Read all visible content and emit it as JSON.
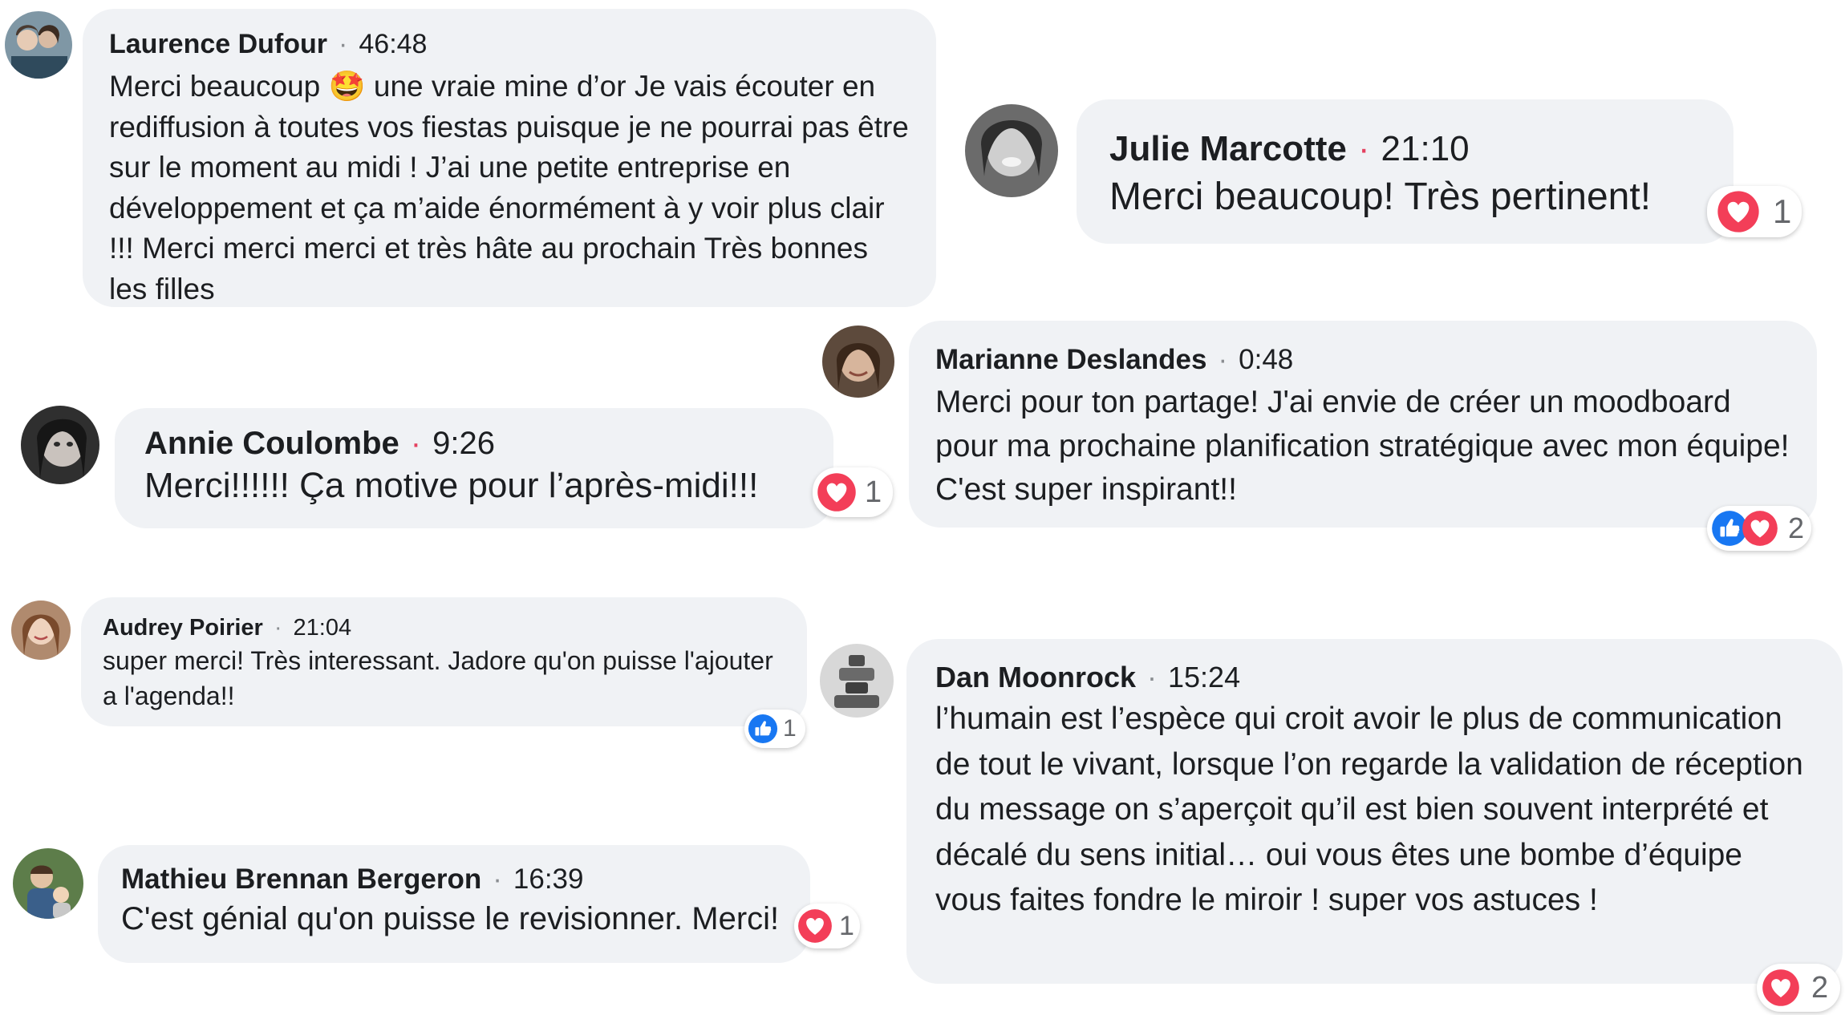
{
  "colors": {
    "bubble": "#f0f2f5",
    "like": "#1877f2",
    "love": "#f33e58",
    "muted": "#65676b"
  },
  "comments": [
    {
      "author": "Laurence Dufour",
      "time": "46:48",
      "text": "Merci beaucoup 🤩 une vraie mine d’or Je vais écouter en rediffusion à toutes vos fiestas puisque je ne pourrai pas être sur le moment au midi ! J’ai une petite entreprise en développement et ça m’aide énormément à y voir plus clair !!! Merci merci merci et très hâte au prochain Très bonnes les filles"
    },
    {
      "author": "Julie Marcotte",
      "time": "21:10",
      "text": "Merci beaucoup! Très pertinent!",
      "reactions": {
        "icons": [
          "love-icon"
        ],
        "count": "1"
      }
    },
    {
      "author": "Marianne Deslandes",
      "time": "0:48",
      "text": "Merci pour ton partage! J'ai envie de créer un moodboard pour ma prochaine planification stratégique avec mon équipe! C'est super inspirant!!",
      "reactions": {
        "icons": [
          "like-icon",
          "love-icon"
        ],
        "count": "2"
      }
    },
    {
      "author": "Annie Coulombe",
      "time": "9:26",
      "text": "Merci!!!!!! Ça motive pour l’après-midi!!!",
      "reactions": {
        "icons": [
          "love-icon"
        ],
        "count": "1"
      }
    },
    {
      "author": "Audrey Poirier",
      "time": "21:04",
      "text": "super merci! Très interessant. Jadore qu'on puisse l'ajouter a l'agenda!!",
      "reactions": {
        "icons": [
          "like-icon"
        ],
        "count": "1"
      }
    },
    {
      "author": "Dan Moonrock",
      "time": "15:24",
      "text": "l’humain est l’espèce qui croit avoir le plus de communication de tout le vivant, lorsque l’on regarde la validation de réception du message on s’aperçoit qu’il est bien souvent interprété et décalé du sens initial… oui vous êtes une bombe d’équipe vous faites fondre le miroir ! super vos astuces !",
      "reactions": {
        "icons": [
          "love-icon"
        ],
        "count": "2"
      }
    },
    {
      "author": "Mathieu Brennan Bergeron",
      "time": "16:39",
      "text": "C'est génial qu'on puisse le revisionner. Merci!",
      "reactions": {
        "icons": [
          "love-icon"
        ],
        "count": "1"
      }
    }
  ]
}
